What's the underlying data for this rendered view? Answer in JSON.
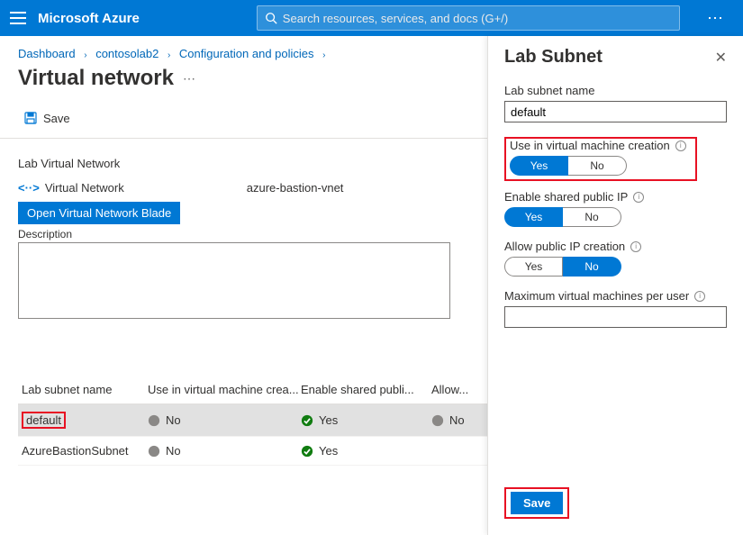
{
  "brand": "Microsoft Azure",
  "search": {
    "placeholder": "Search resources, services, and docs (G+/)"
  },
  "breadcrumbs": [
    "Dashboard",
    "contosolab2",
    "Configuration and policies"
  ],
  "page_title": "Virtual network",
  "toolbar": {
    "save_label": "Save"
  },
  "section": {
    "lab_vn_label": "Lab Virtual Network",
    "vn_row_label": "Virtual Network",
    "vn_name": "azure-bastion-vnet",
    "open_blade_btn": "Open Virtual Network Blade",
    "description_label": "Description",
    "description_value": ""
  },
  "table": {
    "headers": [
      "Lab subnet name",
      "Use in virtual machine crea...",
      "Enable shared publi...",
      "Allow..."
    ],
    "rows": [
      {
        "name": "default",
        "use_vm": "No",
        "shared_ip": "Yes",
        "allow": "No",
        "selected": true,
        "highlight": true
      },
      {
        "name": "AzureBastionSubnet",
        "use_vm": "No",
        "shared_ip": "Yes",
        "allow": "",
        "selected": false,
        "highlight": false
      }
    ]
  },
  "panel": {
    "title": "Lab Subnet",
    "subnet_name_label": "Lab subnet name",
    "subnet_name_value": "default",
    "use_vm_label": "Use in virtual machine creation",
    "use_vm_value": "Yes",
    "shared_ip_label": "Enable shared public IP",
    "shared_ip_value": "Yes",
    "allow_ip_label": "Allow public IP creation",
    "allow_ip_value": "No",
    "max_vm_label": "Maximum virtual machines per user",
    "max_vm_value": "",
    "save_label": "Save",
    "yes": "Yes",
    "no": "No"
  }
}
